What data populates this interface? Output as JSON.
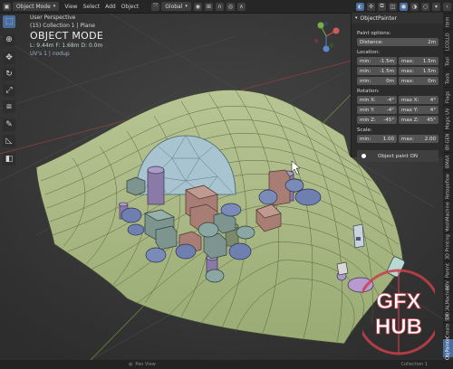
{
  "header": {
    "mode_label": "Object Mode",
    "menus": [
      "View",
      "Select",
      "Add",
      "Object"
    ],
    "orientation": "Global"
  },
  "toolbar": {
    "tools": [
      "select-icon",
      "cursor-icon",
      "move-icon",
      "rotate-icon",
      "scale-icon",
      "transform-icon",
      "annotate-icon",
      "measure-icon",
      "add-cube-icon"
    ]
  },
  "viewport": {
    "view_name": "User Perspective",
    "collection": "(15) Collection 1 | Plane",
    "mode_title": "OBJECT MODE",
    "stats": "L: 9.44m  F: 1.68m  D: 0.0m",
    "units": "UV's 1 | nodup"
  },
  "npanel": {
    "title": "ObjectPainter",
    "paint_options": "Paint options:",
    "distance_label": "Distance:",
    "distance_value": "2m",
    "location_label": "Location:",
    "location_rows": [
      {
        "min_label": "min:",
        "min": "-1.5m",
        "max_label": "max:",
        "max": "1.5m"
      },
      {
        "min_label": "min:",
        "min": "-1.5m",
        "max_label": "max:",
        "max": "1.5m"
      },
      {
        "min_label": "min:",
        "min": "0m",
        "max_label": "max:",
        "max": "0m"
      }
    ],
    "rotation_label": "Rotation:",
    "rotation_rows": [
      {
        "min_label": "min X:",
        "min": "-4°",
        "max_label": "max X:",
        "max": "4°"
      },
      {
        "min_label": "min Y:",
        "min": "-4°",
        "max_label": "max Y:",
        "max": "4°"
      },
      {
        "min_label": "min Z:",
        "min": "-45°",
        "max_label": "max Z:",
        "max": "45°"
      }
    ],
    "scale_label": "Scale:",
    "scale_row": {
      "min_label": "min:",
      "min": "1.00",
      "max_label": "max:",
      "max": "2.00"
    },
    "paint_button": "Object paint ON"
  },
  "side_tabs": [
    "Item",
    "LCOLLO",
    "Tool",
    "Tools",
    "Flags",
    "Magic UV",
    "BY-GEN",
    "BMAX",
    "Retopoflow",
    "MeshMachine",
    "3D Printing",
    "Parent",
    "BDV",
    "DECALMachine",
    "SW",
    "Create",
    "ObjPainter"
  ],
  "active_side_tab": "ObjPainter",
  "footer": {
    "left": "Pan View",
    "right": "Collection 1"
  },
  "watermark": {
    "line1": "GFX",
    "line2": "HUB"
  }
}
